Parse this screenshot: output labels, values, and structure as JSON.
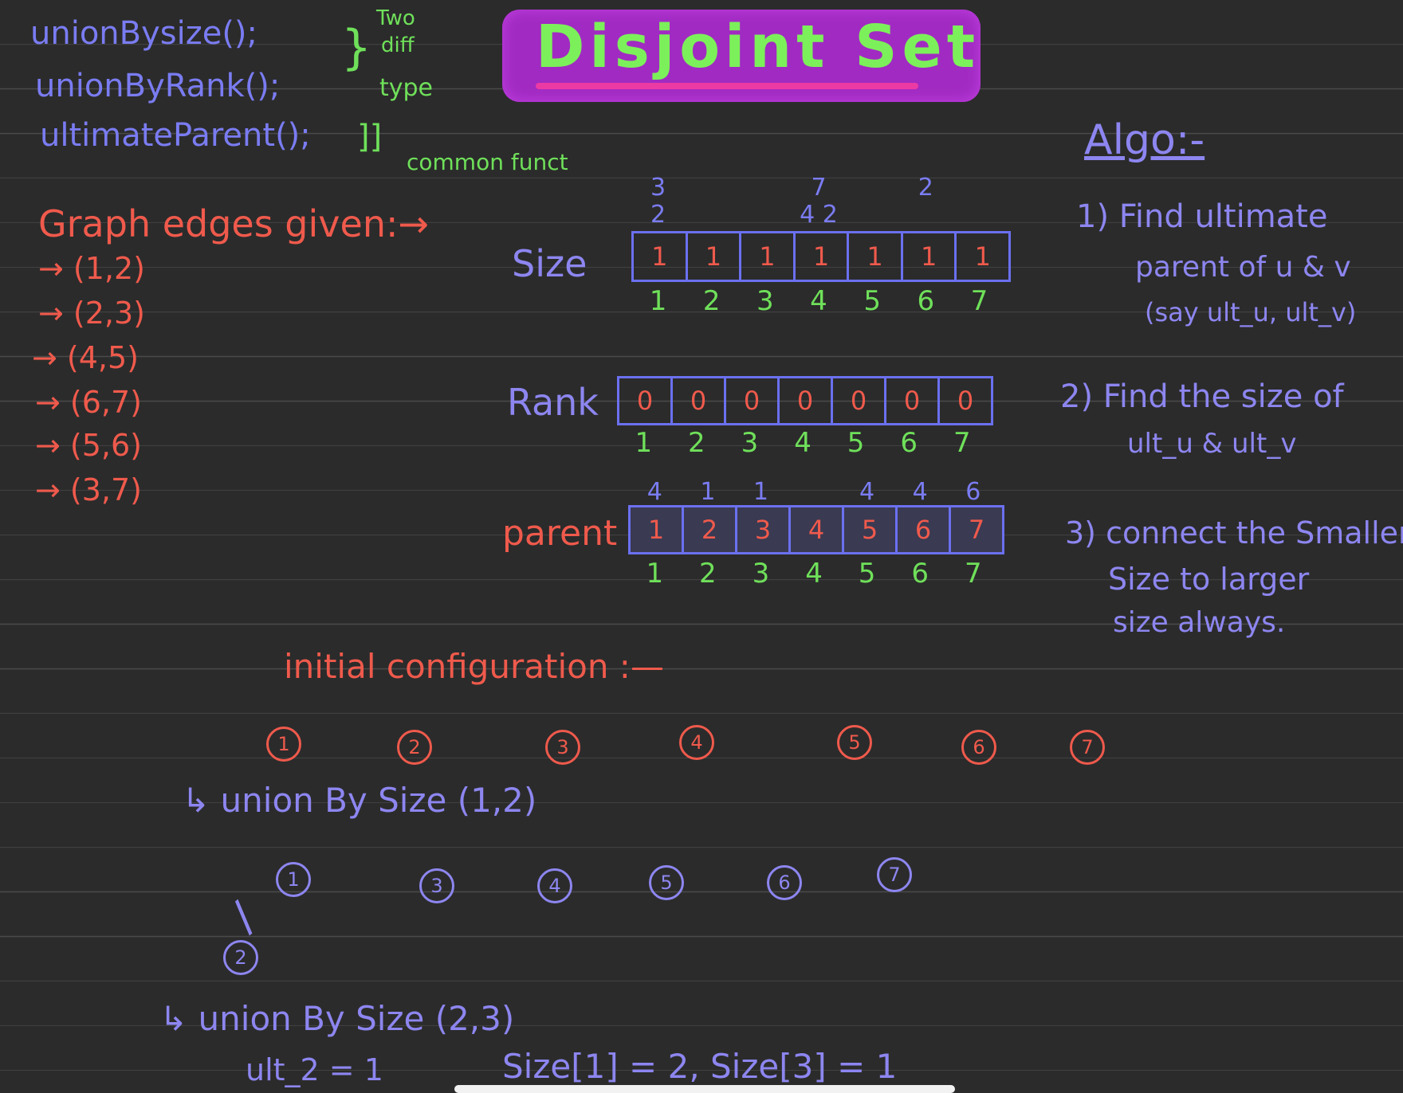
{
  "top_notes": {
    "line1": "unionBysize();",
    "line2": "unionByRank();",
    "line3": "ultimateParent();",
    "two_diff": "Two",
    "diff": "diff",
    "type": "type",
    "common": "common funct"
  },
  "title": "Disjoint Set",
  "graph": {
    "heading": "Graph edges given:→",
    "edges": [
      "→ (1,2)",
      "→ (2,3)",
      "→ (4,5)",
      "→ (6,7)",
      "→ (5,6)",
      "→ (3,7)"
    ]
  },
  "size": {
    "label": "Size",
    "cells": [
      "1",
      "1",
      "1",
      "1",
      "1",
      "1",
      "1"
    ],
    "indices": [
      "1",
      "2",
      "3",
      "4",
      "5",
      "6",
      "7"
    ],
    "above": [
      "3",
      "",
      "",
      "7",
      "",
      "2",
      ""
    ],
    "above2": [
      "2",
      "",
      "",
      "4 2",
      "",
      "",
      ""
    ]
  },
  "rank": {
    "label": "Rank",
    "cells": [
      "0",
      "0",
      "0",
      "0",
      "0",
      "0",
      "0"
    ],
    "indices": [
      "1",
      "2",
      "3",
      "4",
      "5",
      "6",
      "7"
    ]
  },
  "parent": {
    "label": "parent",
    "cells": [
      "1",
      "2",
      "3",
      "4",
      "5",
      "6",
      "7"
    ],
    "indices": [
      "1",
      "2",
      "3",
      "4",
      "5",
      "6",
      "7"
    ],
    "above": [
      "4",
      "1",
      "1",
      "",
      "4",
      "4",
      "6"
    ]
  },
  "algo": {
    "heading": "Algo:-",
    "step1a": "1) Find ultimate",
    "step1b": "parent of u & v",
    "step1c": "(say ult_u, ult_v)",
    "step2a": "2) Find the size of",
    "step2b": "ult_u & ult_v",
    "step3a": "3) connect the Smaller",
    "step3b": "Size to larger",
    "step3c": "size always."
  },
  "initial": {
    "heading": "initial configuration :—",
    "nodes": [
      "1",
      "2",
      "3",
      "4",
      "5",
      "6",
      "7"
    ]
  },
  "union1": {
    "heading": "↳ union By Size (1,2)",
    "nodes": [
      "1",
      "3",
      "4",
      "5",
      "6",
      "7"
    ],
    "child": "2"
  },
  "union2": {
    "heading": "↳ union By Size (2,3)",
    "line": "ult_2 = 1",
    "sizes": "Size[1] = 2, Size[3] = 1"
  }
}
